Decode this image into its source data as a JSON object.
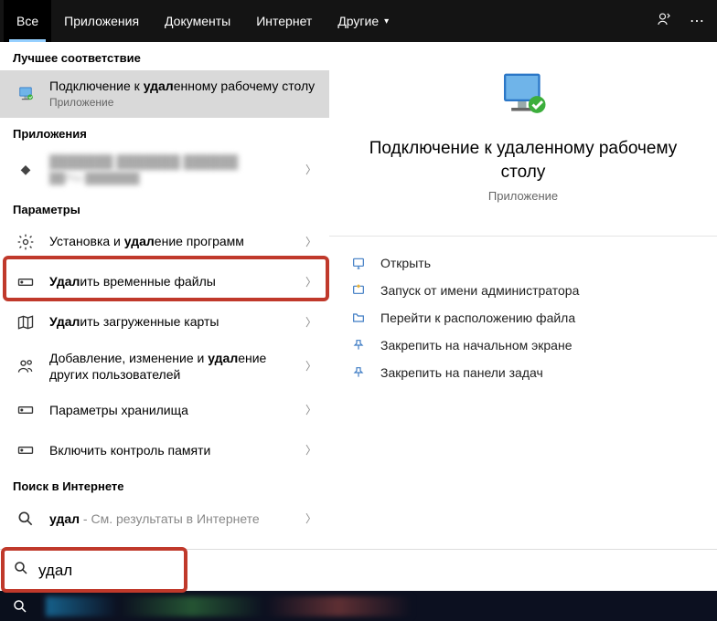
{
  "tabs": {
    "all": "Все",
    "apps": "Приложения",
    "docs": "Документы",
    "net": "Интернет",
    "other": "Другие"
  },
  "sections": {
    "best": "Лучшее соответствие",
    "apps": "Приложения",
    "params": "Параметры",
    "web": "Поиск в Интернете"
  },
  "best": {
    "title_pre": "Подключение к ",
    "title_b": "удал",
    "title_post": "енному рабочему столу",
    "sub": "Приложение"
  },
  "blurred": {
    "title": "███████ ███████ ██████",
    "sub": "██Pro ███████"
  },
  "params": [
    {
      "pre": "Установка и ",
      "b": "удал",
      "post": "ение программ",
      "icon": "gear"
    },
    {
      "pre": "",
      "b": "Удал",
      "post": "ить временные файлы",
      "icon": "storage"
    },
    {
      "pre": "",
      "b": "Удал",
      "post": "ить загруженные карты",
      "icon": "map"
    },
    {
      "pre": "Добавление, изменение и ",
      "b": "удал",
      "post": "ение других пользователей",
      "icon": "people"
    },
    {
      "pre": "Параметры хранилища",
      "b": "",
      "post": "",
      "icon": "storage"
    },
    {
      "pre": "Включить контроль памяти",
      "b": "",
      "post": "",
      "icon": "storage"
    }
  ],
  "web": {
    "q": "удал",
    "suffix": " - См. результаты в Интернете"
  },
  "right": {
    "title": "Подключение к удаленному рабочему столу",
    "sub": "Приложение",
    "actions": [
      {
        "l": "Открыть",
        "i": "open"
      },
      {
        "l": "Запуск от имени администратора",
        "i": "admin"
      },
      {
        "l": "Перейти к расположению файла",
        "i": "folder"
      },
      {
        "l": "Закрепить на начальном экране",
        "i": "pin"
      },
      {
        "l": "Закрепить на панели задач",
        "i": "pin"
      }
    ]
  },
  "search": {
    "value": "удал"
  }
}
